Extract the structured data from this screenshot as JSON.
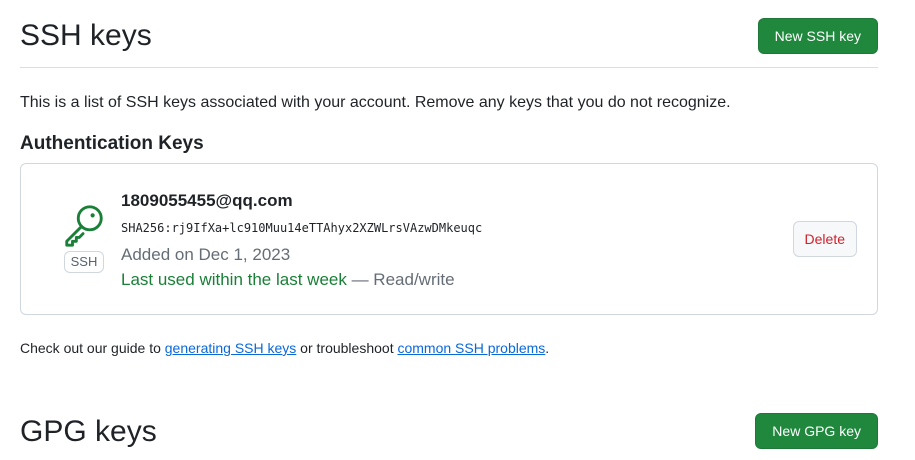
{
  "ssh": {
    "title": "SSH keys",
    "new_button": "New SSH key",
    "intro": "This is a list of SSH keys associated with your account. Remove any keys that you do not recognize.",
    "auth_heading": "Authentication Keys",
    "keys": [
      {
        "title": "1809055455@qq.com",
        "fingerprint": "SHA256:rj9IfXa+lc910Muu14eTTAhyx2XZWLrsVAzwDMkeuqc",
        "badge": "SSH",
        "added": "Added on Dec 1, 2023",
        "last_used": "Last used within the last week",
        "access": " — Read/write",
        "delete_label": "Delete",
        "icon": "key-icon"
      }
    ],
    "guide": {
      "prefix": "Check out our guide to ",
      "link1": "generating SSH keys",
      "middle": " or troubleshoot ",
      "link2": "common SSH problems",
      "suffix": "."
    }
  },
  "gpg": {
    "title": "GPG keys",
    "new_button": "New GPG key"
  },
  "colors": {
    "primary_button": "#1f883d",
    "danger_text": "#cf222e",
    "success_text": "#1a7f37",
    "link": "#0969da",
    "muted_text": "#656d76"
  }
}
